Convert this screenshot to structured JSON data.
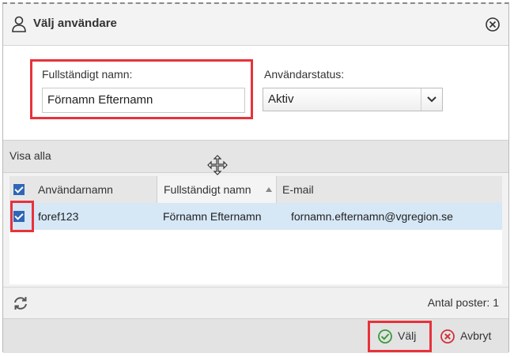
{
  "dialog": {
    "title": "Välj användare",
    "icons": {
      "title": "user-icon",
      "close": "close-circle-icon"
    }
  },
  "filters": {
    "name_label": "Fullständigt namn:",
    "name_value": "Förnamn Efternamn",
    "status_label": "Användarstatus:",
    "status_value": "Aktiv"
  },
  "toolbar": {
    "show_all": "Visa alla"
  },
  "grid": {
    "columns": [
      "Användarnamn",
      "Fullständigt namn",
      "E-mail"
    ],
    "rows": [
      {
        "username": "foref123",
        "fullname": "Förnamn Efternamn",
        "email": "fornamn.efternamn@vgregion.se",
        "checked": true
      }
    ]
  },
  "footer": {
    "count_label": "Antal poster: 1",
    "select_label": "Välj",
    "cancel_label": "Avbryt"
  },
  "colors": {
    "highlight": "#e8323a",
    "selected_row": "#d6e7f6",
    "ok_green": "#3a9a3a",
    "cancel_red": "#d0333c"
  }
}
